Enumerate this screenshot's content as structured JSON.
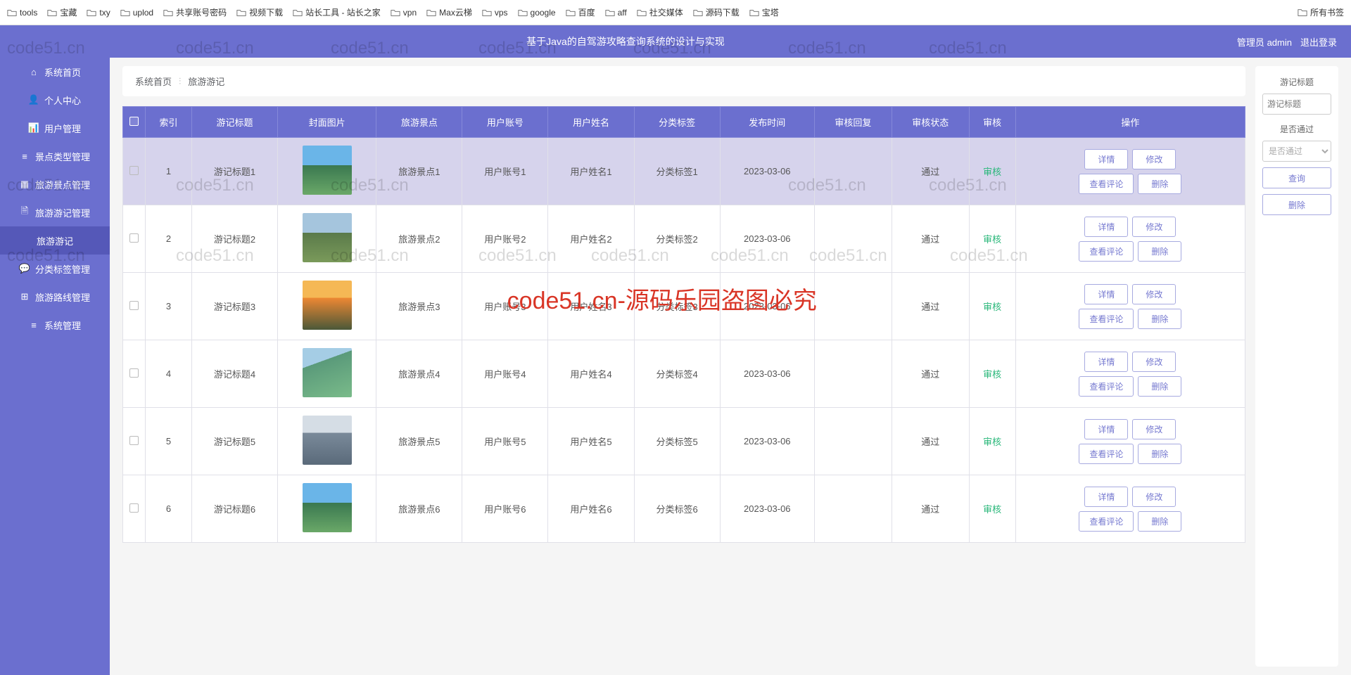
{
  "bookmarks": [
    {
      "label": "tools",
      "icon": "folder"
    },
    {
      "label": "宝藏",
      "icon": "folder"
    },
    {
      "label": "txy",
      "icon": "cloud"
    },
    {
      "label": "uplod",
      "icon": "share"
    },
    {
      "label": "共享账号密码",
      "icon": "sheet"
    },
    {
      "label": "视频下载",
      "icon": "folder"
    },
    {
      "label": "站长工具 - 站长之家",
      "icon": "tool"
    },
    {
      "label": "vpn",
      "icon": "folder"
    },
    {
      "label": "Max云梯",
      "icon": "folder"
    },
    {
      "label": "vps",
      "icon": "folder"
    },
    {
      "label": "google",
      "icon": "folder"
    },
    {
      "label": "百度",
      "icon": "baidu"
    },
    {
      "label": "aff",
      "icon": "folder"
    },
    {
      "label": "社交媒体",
      "icon": "folder"
    },
    {
      "label": "源码下载",
      "icon": "folder"
    },
    {
      "label": "宝塔",
      "icon": "folder"
    }
  ],
  "bookmarks_right": {
    "label": "所有书签",
    "icon": "folder"
  },
  "header": {
    "title": "基于Java的自驾游攻略查询系统的设计与实现",
    "user_prefix": "管理员",
    "user": "admin",
    "logout": "退出登录"
  },
  "sidebar": {
    "items": [
      {
        "label": "系统首页",
        "icon": "home"
      },
      {
        "label": "个人中心",
        "icon": "user"
      },
      {
        "label": "用户管理",
        "icon": "chart"
      },
      {
        "label": "景点类型管理",
        "icon": "list"
      },
      {
        "label": "旅游景点管理",
        "icon": "grid"
      },
      {
        "label": "旅游游记管理",
        "icon": "doc"
      },
      {
        "label": "旅游游记",
        "icon": ""
      },
      {
        "label": "分类标签管理",
        "icon": "tag"
      },
      {
        "label": "旅游路线管理",
        "icon": "route"
      },
      {
        "label": "系统管理",
        "icon": "list"
      }
    ],
    "active_index": 6
  },
  "breadcrumb": {
    "home": "系统首页",
    "sep": "⫶",
    "current": "旅游游记"
  },
  "table": {
    "headers": [
      "",
      "索引",
      "游记标题",
      "封面图片",
      "旅游景点",
      "用户账号",
      "用户姓名",
      "分类标签",
      "发布时间",
      "审核回复",
      "审核状态",
      "审核",
      "操作"
    ],
    "op_buttons": [
      "详情",
      "修改",
      "查看评论",
      "删除"
    ],
    "rows": [
      {
        "idx": "1",
        "title": "游记标题1",
        "thumb": "t1",
        "spot": "旅游景点1",
        "acct": "用户账号1",
        "name": "用户姓名1",
        "tag": "分类标签1",
        "date": "2023-03-06",
        "reply": "",
        "status": "通过",
        "audit": "审核",
        "hl": true
      },
      {
        "idx": "2",
        "title": "游记标题2",
        "thumb": "t2",
        "spot": "旅游景点2",
        "acct": "用户账号2",
        "name": "用户姓名2",
        "tag": "分类标签2",
        "date": "2023-03-06",
        "reply": "",
        "status": "通过",
        "audit": "审核"
      },
      {
        "idx": "3",
        "title": "游记标题3",
        "thumb": "t3",
        "spot": "旅游景点3",
        "acct": "用户账号3",
        "name": "用户姓名3",
        "tag": "分类标签3",
        "date": "2023-03-06",
        "reply": "",
        "status": "通过",
        "audit": "审核"
      },
      {
        "idx": "4",
        "title": "游记标题4",
        "thumb": "t4",
        "spot": "旅游景点4",
        "acct": "用户账号4",
        "name": "用户姓名4",
        "tag": "分类标签4",
        "date": "2023-03-06",
        "reply": "",
        "status": "通过",
        "audit": "审核"
      },
      {
        "idx": "5",
        "title": "游记标题5",
        "thumb": "t5",
        "spot": "旅游景点5",
        "acct": "用户账号5",
        "name": "用户姓名5",
        "tag": "分类标签5",
        "date": "2023-03-06",
        "reply": "",
        "status": "通过",
        "audit": "审核"
      },
      {
        "idx": "6",
        "title": "游记标题6",
        "thumb": "t1",
        "spot": "旅游景点6",
        "acct": "用户账号6",
        "name": "用户姓名6",
        "tag": "分类标签6",
        "date": "2023-03-06",
        "reply": "",
        "status": "通过",
        "audit": "审核"
      }
    ]
  },
  "filter": {
    "title_label": "游记标题",
    "title_placeholder": "游记标题",
    "pass_label": "是否通过",
    "pass_placeholder": "是否通过",
    "query": "查询",
    "delete": "删除"
  },
  "watermark": {
    "red": "code51.cn-源码乐园盗图必究",
    "grey": "code51.cn"
  }
}
